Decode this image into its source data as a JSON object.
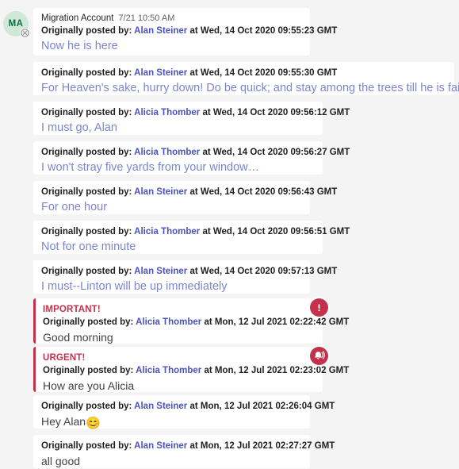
{
  "thread": {
    "avatar": {
      "initials": "MA",
      "presence_icon": "blocked-status-icon"
    },
    "header": {
      "sender": "Migration Account",
      "timestamp": "7/21 10:50 AM"
    },
    "colors": {
      "page_background": "#f4f4f4",
      "card_background": "#ffffff",
      "link": "#4b53bc",
      "migrated_body_text": "#7b86cf",
      "plain_body_text": "#424242",
      "priority_red": "#c4314b",
      "avatar_background": "#cfe8d8",
      "avatar_text": "#0f6c45"
    },
    "labels": {
      "originally_posted_by": "Originally posted by:",
      "at": "at",
      "important": "IMPORTANT!",
      "urgent": "URGENT!"
    },
    "messages": [
      {
        "id": "msg-1",
        "show_header": true,
        "sender": "Migration Account",
        "timestamp": "7/21 10:50 AM",
        "author": "Alan Steiner",
        "posted_at": "Wed, 14 Oct 2020 09:55:23 GMT",
        "text": "Now he is here",
        "style": "migrated",
        "priority": null,
        "priority_icon": null
      },
      {
        "id": "msg-2",
        "show_header": false,
        "author": "Alan Steiner",
        "posted_at": "Wed, 14 Oct 2020 09:55:30 GMT",
        "text": "For Heaven's sake, hurry down! Do be quick; and stay among the trees till he is fairly in",
        "style": "migrated",
        "priority": null,
        "priority_icon": null
      },
      {
        "id": "msg-3",
        "show_header": false,
        "author": "Alicia Thomber",
        "posted_at": "Wed, 14 Oct 2020 09:56:12 GMT",
        "text": "I must go, Alan",
        "style": "migrated",
        "priority": null,
        "priority_icon": null
      },
      {
        "id": "msg-4",
        "show_header": false,
        "author": "Alicia Thomber",
        "posted_at": "Wed, 14 Oct 2020 09:56:27 GMT",
        "text": "I won't stray five yards from your window…",
        "style": "migrated",
        "priority": null,
        "priority_icon": null
      },
      {
        "id": "msg-5",
        "show_header": false,
        "author": "Alan Steiner",
        "posted_at": "Wed, 14 Oct 2020 09:56:43 GMT",
        "text": "For one hour",
        "style": "migrated",
        "priority": null,
        "priority_icon": null
      },
      {
        "id": "msg-6",
        "show_header": false,
        "author": "Alicia Thomber",
        "posted_at": "Wed, 14 Oct 2020 09:56:51 GMT",
        "text": "Not for one minute",
        "style": "migrated",
        "priority": null,
        "priority_icon": null
      },
      {
        "id": "msg-7",
        "show_header": false,
        "author": "Alan Steiner",
        "posted_at": "Wed, 14 Oct 2020 09:57:13 GMT",
        "text": "I must--Linton will be up immediately",
        "style": "migrated",
        "priority": null,
        "priority_icon": null
      },
      {
        "id": "msg-8",
        "show_header": false,
        "author": "Alicia Thomber",
        "posted_at": "Mon, 12 Jul 2021 02:22:42 GMT",
        "text": "Good morning",
        "style": "plain",
        "priority": "IMPORTANT!",
        "priority_icon": "important-exclamation-icon"
      },
      {
        "id": "msg-9",
        "show_header": false,
        "author": "Alicia Thomber",
        "posted_at": "Mon, 12 Jul 2021 02:23:02 GMT",
        "text": "How are you Alicia",
        "style": "plain",
        "priority": "URGENT!",
        "priority_icon": "urgent-bell-icon"
      },
      {
        "id": "msg-10",
        "show_header": false,
        "author": "Alan Steiner",
        "posted_at": "Mon, 12 Jul 2021 02:26:04 GMT",
        "text": "Hey Alan",
        "emoji": "😊",
        "style": "plain",
        "priority": null,
        "priority_icon": null
      },
      {
        "id": "msg-11",
        "show_header": false,
        "author": "Alan Steiner",
        "posted_at": "Mon, 12 Jul 2021 02:27:27 GMT",
        "text": "all good",
        "style": "plain",
        "priority": null,
        "priority_icon": null
      }
    ]
  }
}
